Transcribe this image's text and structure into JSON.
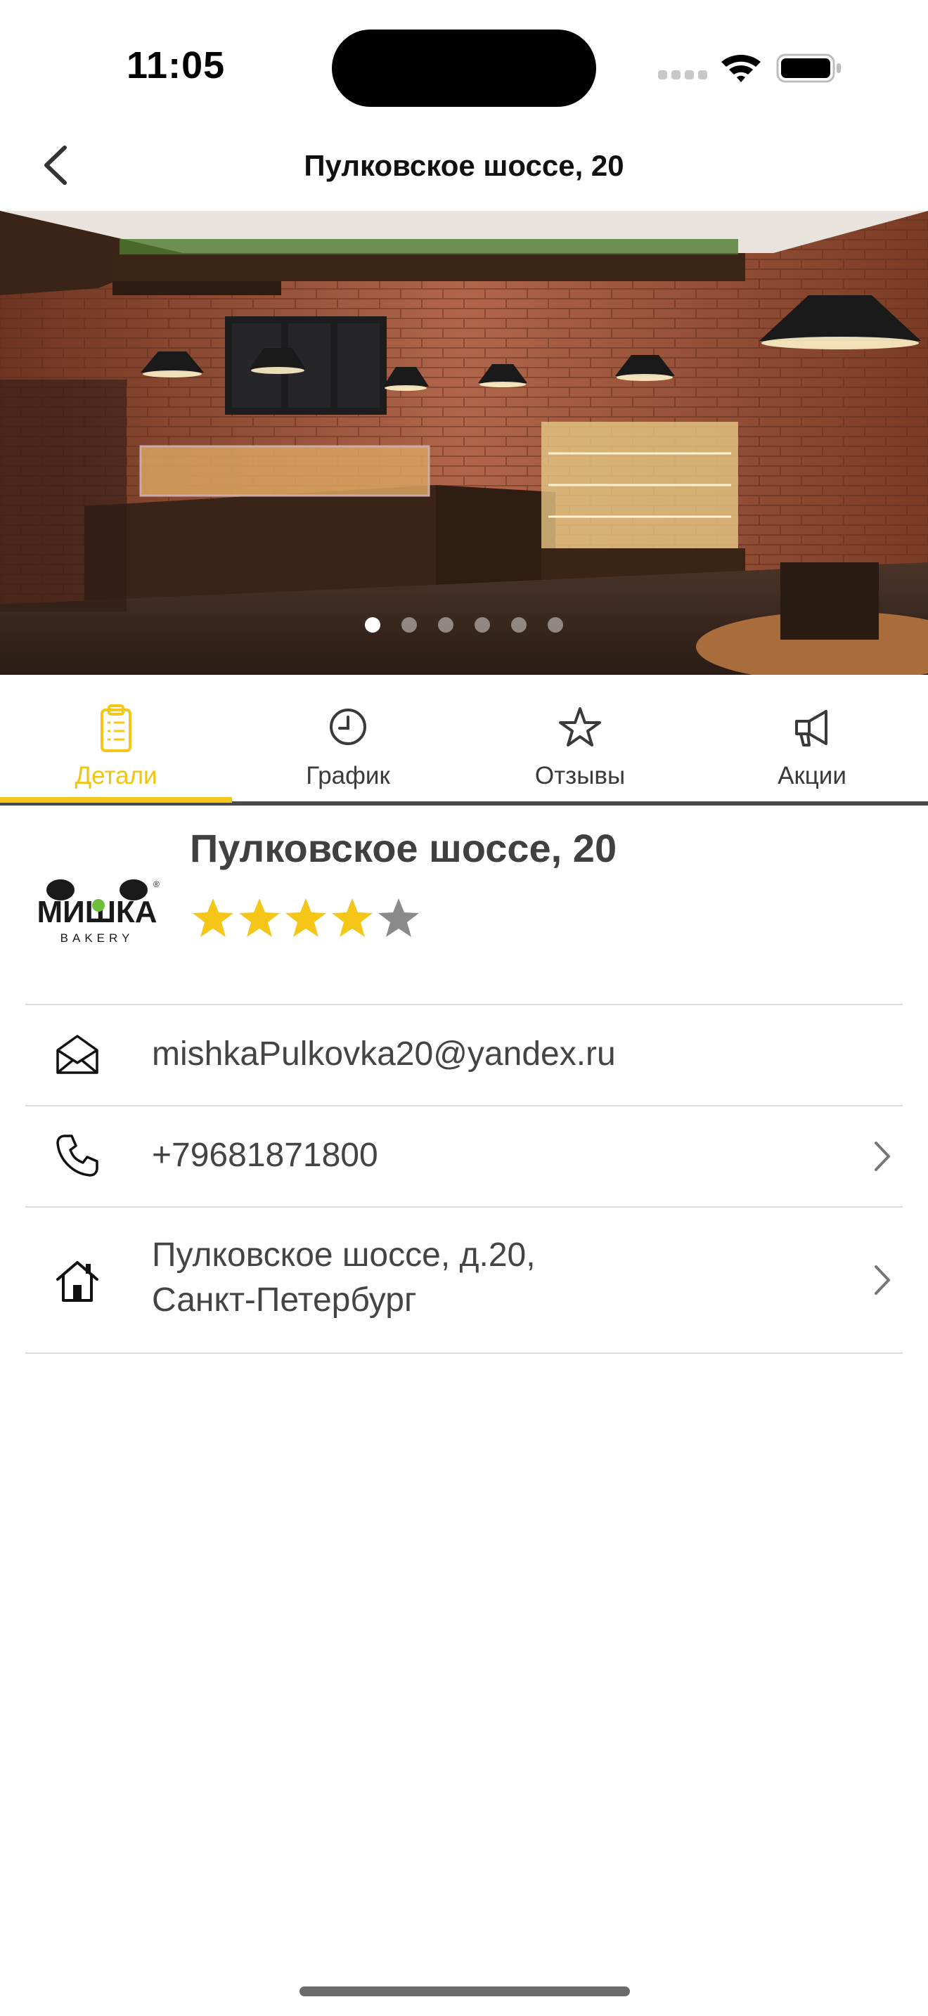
{
  "status_bar": {
    "time": "11:05"
  },
  "nav": {
    "title": "Пулковское шоссе, 20",
    "back_icon": "chevron-left-icon"
  },
  "hero": {
    "description_icon": "bakery-photo",
    "page_count": 6,
    "active_page": 1
  },
  "tabs": [
    {
      "label": "Детали",
      "icon": "clipboard-icon",
      "active": true
    },
    {
      "label": "График",
      "icon": "clock-icon",
      "active": false
    },
    {
      "label": "Отзывы",
      "icon": "star-outline-icon",
      "active": false
    },
    {
      "label": "Акции",
      "icon": "megaphone-icon",
      "active": false
    }
  ],
  "place": {
    "name": "Пулковское шоссе, 20",
    "logo_text": "МИШКА",
    "logo_subtext": "BAKERY",
    "rating": 4,
    "rating_max": 5
  },
  "contacts": {
    "email": "mishkaPulkovka20@yandex.ru",
    "phone": "+79681871800",
    "address_line1": "Пулковское шоссе, д.20,",
    "address_line2": "Санкт-Петербург"
  },
  "colors": {
    "accent": "#f5c518",
    "text": "#444444",
    "divider": "#dcdcdc"
  }
}
